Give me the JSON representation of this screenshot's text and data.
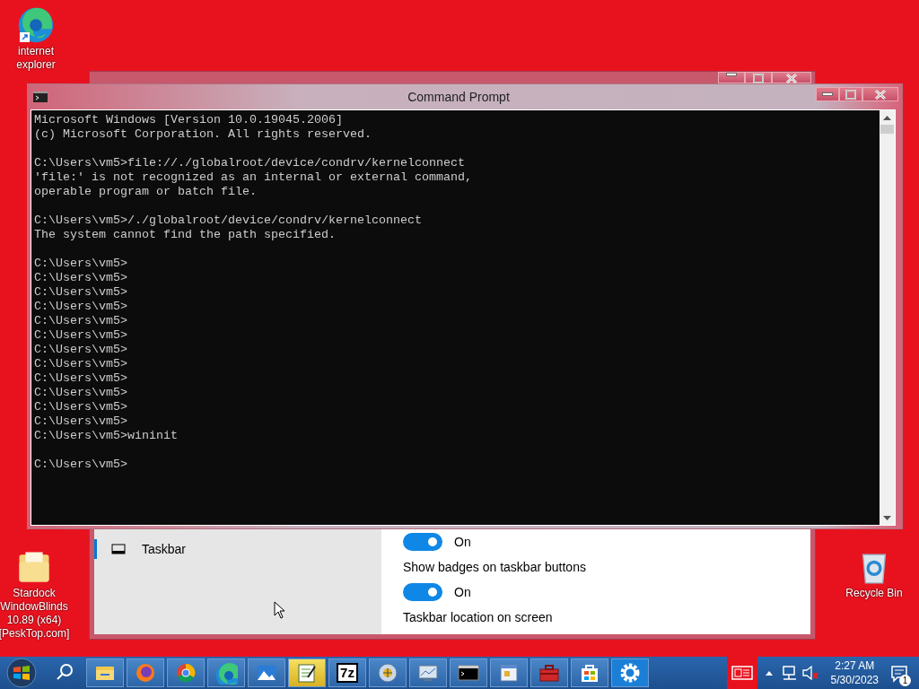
{
  "desktop_icons": [
    {
      "kind": "edge",
      "label": "internet explorer"
    },
    {
      "kind": "folder",
      "label": "Stardock WindowBlinds 10.89 (x64)[PeskTop.com]"
    },
    {
      "kind": "recycle",
      "label": "Recycle Bin"
    }
  ],
  "settings_window": {
    "sidebar_items": [
      {
        "label": "Taskbar",
        "selected": true
      }
    ],
    "rows": [
      {
        "kind": "toggle",
        "on": true,
        "state_label": "On"
      },
      {
        "kind": "label",
        "text": "Show badges on taskbar buttons"
      },
      {
        "kind": "toggle",
        "on": true,
        "state_label": "On"
      },
      {
        "kind": "label",
        "text": "Taskbar location on screen"
      }
    ]
  },
  "cmd_window": {
    "title": "Command Prompt",
    "blocks": [
      [
        "Microsoft Windows [Version 10.0.19045.2006]",
        "(c) Microsoft Corporation. All rights reserved."
      ],
      [
        "C:\\Users\\vm5>file://./globalroot/device/condrv/kernelconnect",
        "'file:' is not recognized as an internal or external command,",
        "operable program or batch file."
      ],
      [
        "C:\\Users\\vm5>/./globalroot/device/condrv/kernelconnect",
        "The system cannot find the path specified."
      ],
      [
        "C:\\Users\\vm5>",
        "C:\\Users\\vm5>",
        "C:\\Users\\vm5>",
        "C:\\Users\\vm5>",
        "C:\\Users\\vm5>",
        "C:\\Users\\vm5>",
        "C:\\Users\\vm5>",
        "C:\\Users\\vm5>",
        "C:\\Users\\vm5>",
        "C:\\Users\\vm5>",
        "C:\\Users\\vm5>",
        "C:\\Users\\vm5>",
        "C:\\Users\\vm5>wininit"
      ],
      [
        "C:\\Users\\vm5>"
      ]
    ]
  },
  "taskbar": {
    "apps": [
      {
        "kind": "explorer"
      },
      {
        "kind": "firefox"
      },
      {
        "kind": "chrome"
      },
      {
        "kind": "edge"
      },
      {
        "kind": "photos"
      },
      {
        "kind": "notepad"
      },
      {
        "kind": "text",
        "text": "7z"
      },
      {
        "kind": "globe"
      },
      {
        "kind": "monitor"
      },
      {
        "kind": "cmd"
      },
      {
        "kind": "window"
      },
      {
        "kind": "toolbox"
      },
      {
        "kind": "store"
      },
      {
        "kind": "gear"
      }
    ],
    "time": "2:27 AM",
    "date": "5/30/2023",
    "notification_count": "1"
  }
}
